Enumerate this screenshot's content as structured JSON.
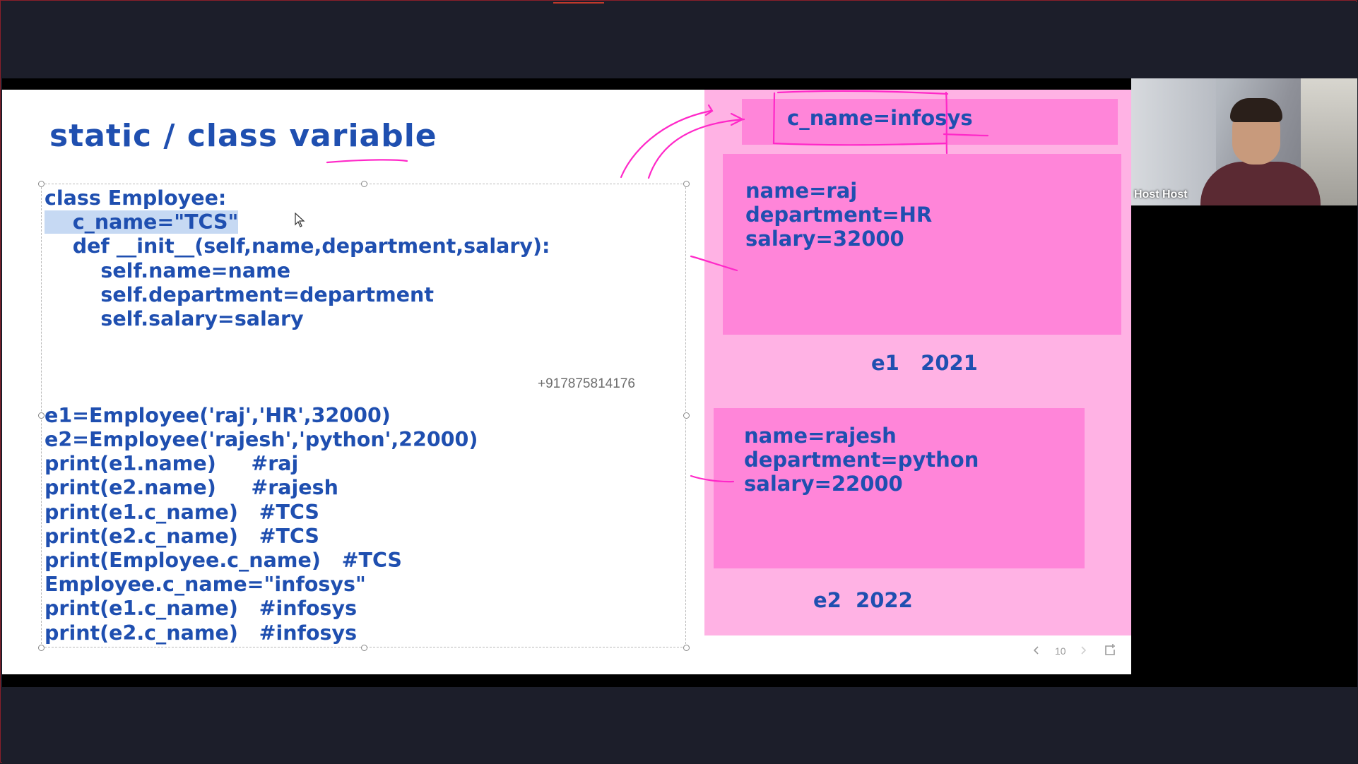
{
  "slide": {
    "title": "static / class variable",
    "code_lines": [
      "class Employee:",
      "    c_name=\"TCS\"",
      "    def __init__(self,name,department,salary):",
      "        self.name=name",
      "        self.department=department",
      "        self.salary=salary",
      "e1=Employee('raj','HR',32000)",
      "e2=Employee('rajesh','python',22000)",
      "print(e1.name)     #raj",
      "print(e2.name)     #rajesh",
      "print(e1.c_name)   #TCS",
      "print(e2.c_name)   #TCS",
      "print(Employee.c_name)   #TCS",
      "Employee.c_name=\"infosys\"",
      "print(e1.c_name)   #infosys",
      "print(e2.c_name)   #infosys"
    ],
    "phone_watermark": "+917875814176",
    "class_box": {
      "text": "c_name=infosys"
    },
    "objects": [
      {
        "lines": [
          "name=raj",
          "department=HR",
          "salary=32000"
        ],
        "label": "e1   2021"
      },
      {
        "lines": [
          "name=rajesh",
          "department=python",
          "salary=22000"
        ],
        "label": "e2  2022"
      }
    ],
    "page_number": "10"
  },
  "video": {
    "participant_name": "Host Host"
  },
  "icons": {
    "prev": "chevron-left-icon",
    "next": "chevron-right-icon",
    "new_window": "new-window-icon",
    "cursor": "mouse-cursor-icon"
  },
  "colors": {
    "code_text": "#1f4fb0",
    "pink_light": "#ffb2e4",
    "pink_box": "#ff85d9",
    "annotation_ink": "#ff28c8",
    "selection": "#c6d9f3"
  }
}
